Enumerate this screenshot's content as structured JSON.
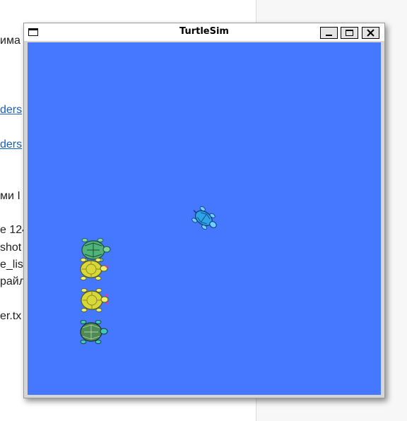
{
  "background_document": {
    "lines": [
      {
        "text": "имa",
        "link": false
      },
      {
        "text": "ders",
        "link": true
      },
      {
        "text": "ders",
        "link": true
      },
      {
        "text": "ми I",
        "link": false
      },
      {
        "text": "e 124",
        "link": false
      },
      {
        "text": "shot",
        "link": false
      },
      {
        "text": "e_lis",
        "link": false
      },
      {
        "text": "райл",
        "link": false
      },
      {
        "text": "er.tx",
        "link": false
      }
    ]
  },
  "window": {
    "title": "TurtleSim",
    "buttons": {
      "minimize": "minimize",
      "maximize": "maximize",
      "close": "close"
    }
  },
  "canvas": {
    "background_color": "#4577ff",
    "turtles": [
      {
        "name": "turtle-blue",
        "color": "#2fa3e8",
        "heading_deg": 120
      },
      {
        "name": "turtle-green",
        "color": "#4fb37a",
        "heading_deg": 0
      },
      {
        "name": "turtle-yellow-1",
        "color": "#d8d83a",
        "heading_deg": 0
      },
      {
        "name": "turtle-yellow-2",
        "color": "#d8d83a",
        "heading_deg": 0
      },
      {
        "name": "turtle-dark-green",
        "color": "#4f8a55",
        "heading_deg": 0
      }
    ]
  },
  "colors": {
    "titlebar": "#ffffff",
    "window_frame": "#d6d6d6",
    "link": "#1a5fb4"
  }
}
